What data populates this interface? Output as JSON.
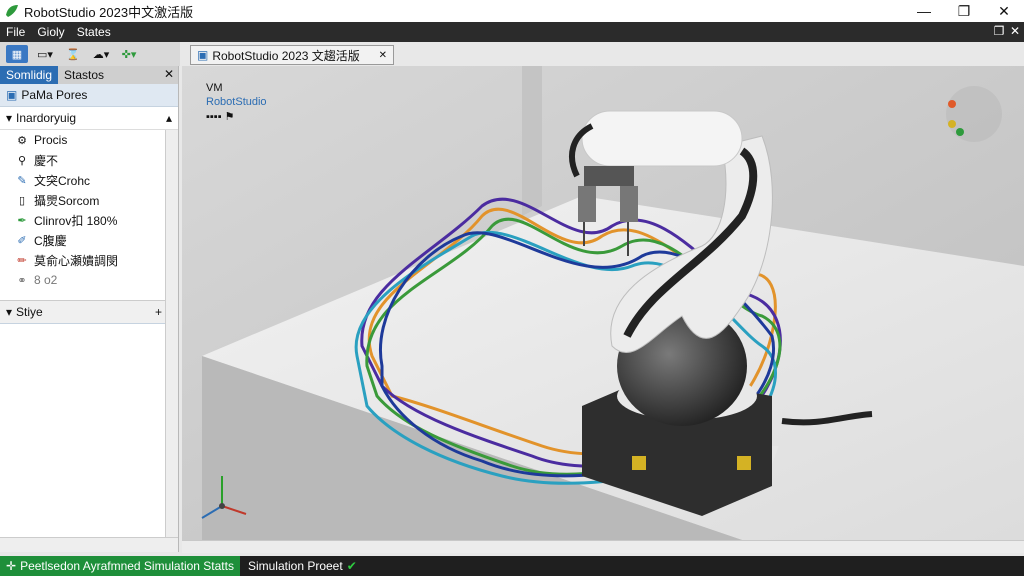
{
  "window": {
    "title": "RobotStudio 2023中文激活版",
    "minimize": "—",
    "maximize": "❐",
    "close": "✕"
  },
  "menubar": {
    "items": [
      "File",
      "Gioly",
      "States"
    ],
    "restore": "❐",
    "close": "✕"
  },
  "panel": {
    "tabs": [
      "Somlidig",
      "Stastos"
    ],
    "close": "✕",
    "section1": "PaMa Pores",
    "section2": "Inardoryuig",
    "items": [
      "Procis",
      "慶不",
      "文突Crohc",
      "攝煛Sorcom",
      "Clinrov扣 180%",
      "C腹慶",
      "莫俞心瀬嬇調閔",
      "8 o2"
    ],
    "section3": "Stiye",
    "plus": "+"
  },
  "doc_tab": {
    "label": "RobotStudio 2023 文趨活版",
    "close": "✕"
  },
  "viewport": {
    "overlay_line1": "VM",
    "overlay_line2": "RobotStudio"
  },
  "status": {
    "left": "Peetlsedon Ayrafmned Simulation Statts",
    "right": "Simulation Proeet",
    "check": "✔"
  },
  "colors": {
    "accent": "#2c6db3",
    "status_green": "#1e8f3a"
  }
}
